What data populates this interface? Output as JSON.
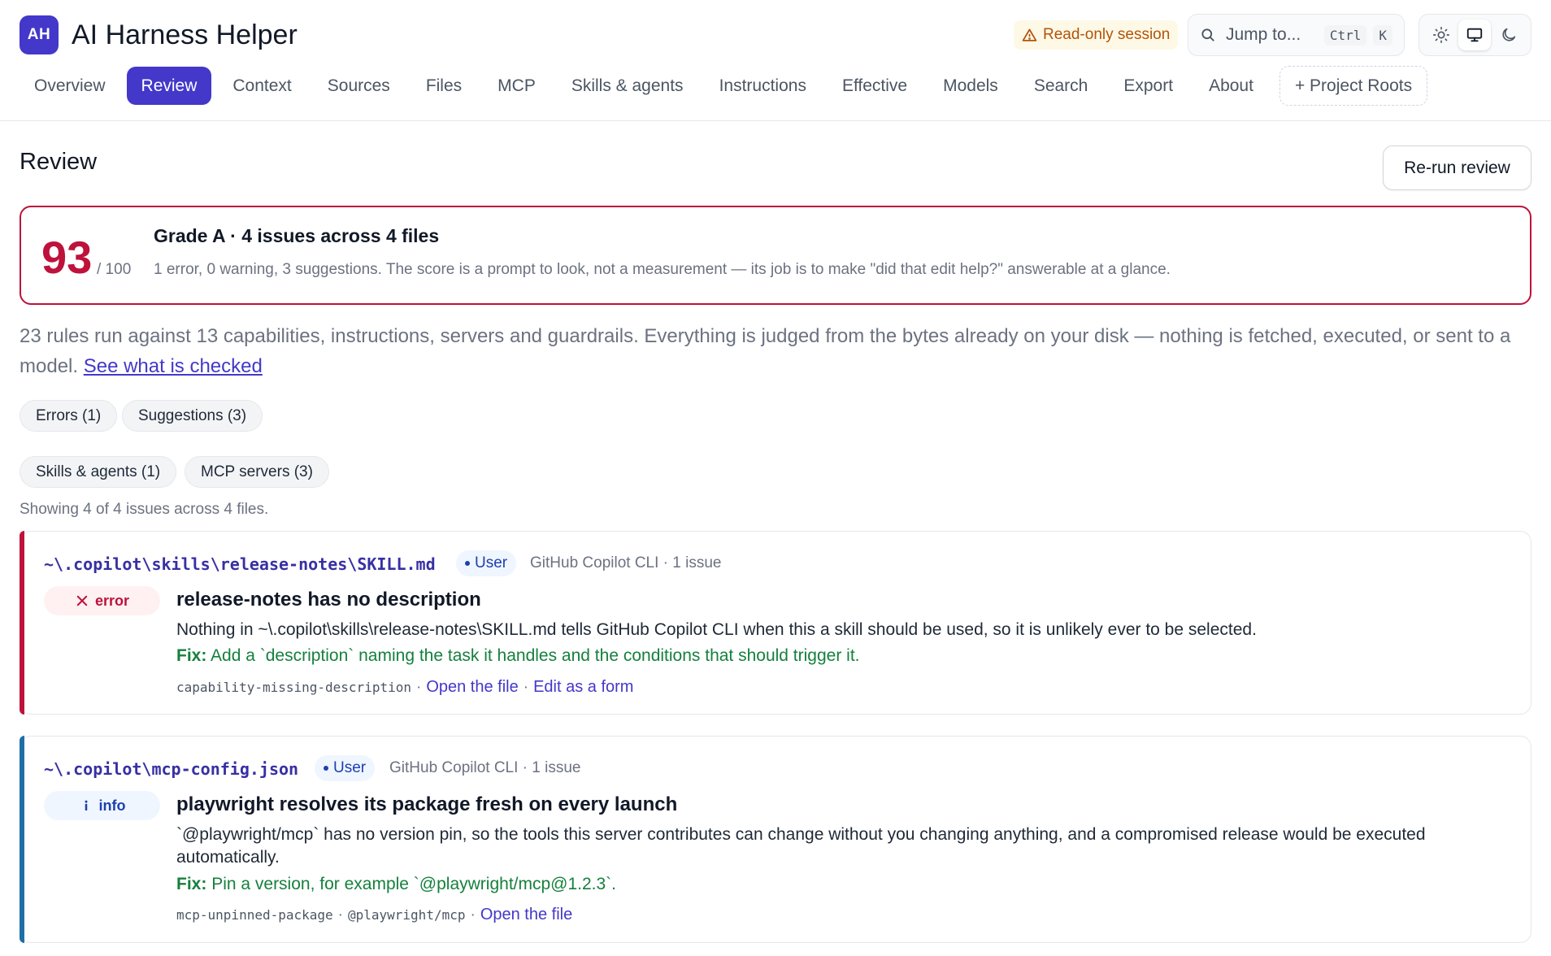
{
  "app": {
    "logo": "AH",
    "title": "AI Harness Helper"
  },
  "header": {
    "readonly_label": "Read-only session",
    "jump_label": "Jump to...",
    "jump_keys": [
      "Ctrl",
      "K"
    ],
    "theme_options": [
      "sun-icon",
      "monitor-icon",
      "moon-icon"
    ],
    "theme_selected": "monitor-icon"
  },
  "nav": {
    "tabs": [
      "Overview",
      "Review",
      "Context",
      "Sources",
      "Files",
      "MCP",
      "Skills & agents",
      "Instructions",
      "Effective",
      "Models",
      "Search",
      "Export",
      "About"
    ],
    "active": "Review",
    "roots_label": "+ Project Roots"
  },
  "page": {
    "title": "Review",
    "rerun_label": "Re-run review"
  },
  "score": {
    "value": "93",
    "max": "/ 100",
    "grade_line": "Grade A · 4 issues across 4 files",
    "summary": "1 error, 0 warning, 3 suggestions. The score is a prompt to look, not a measurement — its job is to make \"did that edit help?\" answerable at a glance."
  },
  "intro": {
    "text": "23 rules run against 13 capabilities, instructions, servers and guardrails. Everything is judged from the bytes already on your disk — nothing is fetched, executed, or sent to a model.",
    "link": "See what is checked"
  },
  "filters": {
    "severity": [
      "Errors (1)",
      "Suggestions (3)"
    ],
    "category": [
      "Skills & agents (1)",
      "MCP servers (3)"
    ]
  },
  "showing": "Showing 4 of 4 issues across 4 files.",
  "issues": [
    {
      "path": "~\\.copilot\\skills\\release-notes\\SKILL.md",
      "scope": "User",
      "meta": "GitHub Copilot CLI · 1 issue",
      "severity": "error",
      "title": "release-notes has no description",
      "description": "Nothing in ~\\.copilot\\skills\\release-notes\\SKILL.md tells GitHub Copilot CLI when this a skill should be used, so it is unlikely ever to be selected.",
      "fix_label": "Fix:",
      "fix": "Add a `description` naming the task it handles and the conditions that should trigger it.",
      "rule": "capability-missing-description",
      "links": [
        "Open the file",
        "Edit as a form"
      ],
      "color": "#be123c"
    },
    {
      "path": "~\\.copilot\\mcp-config.json",
      "scope": "User",
      "meta": "GitHub Copilot CLI · 1 issue",
      "severity": "info",
      "title": "playwright resolves its package fresh on every launch",
      "description": "`@playwright/mcp` has no version pin, so the tools this server contributes can change without you changing anything, and a compromised release would be executed automatically.",
      "fix_label": "Fix:",
      "fix": "Pin a version, for example `@playwright/mcp@1.2.3`.",
      "rule": "mcp-unpinned-package",
      "target": "@playwright/mcp",
      "links": [
        "Open the file"
      ],
      "color": "#1e6fa8"
    }
  ]
}
